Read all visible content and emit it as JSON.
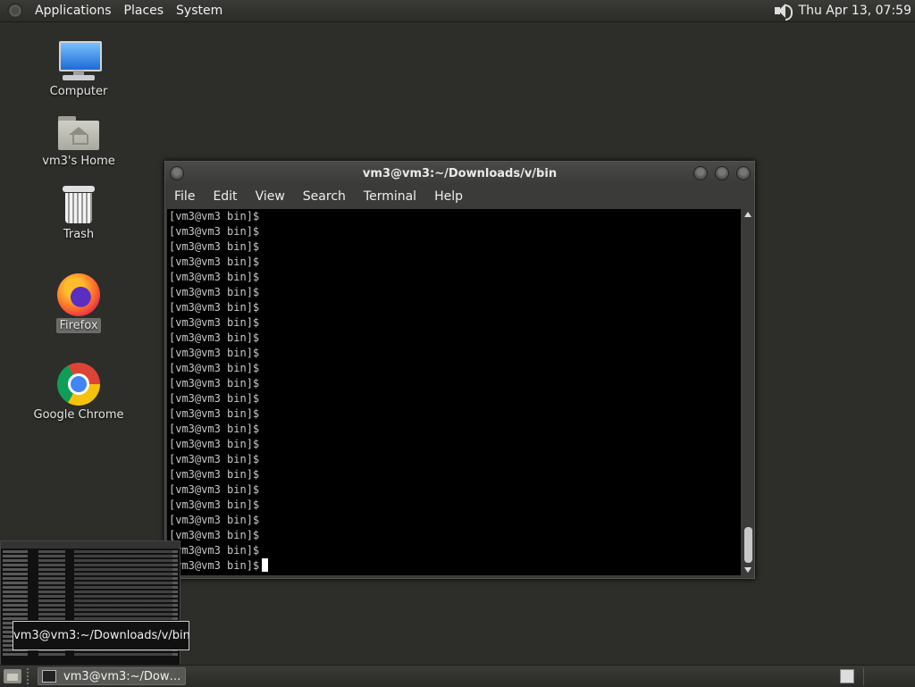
{
  "top_panel": {
    "menus": [
      "Applications",
      "Places",
      "System"
    ],
    "clock": "Thu Apr 13, 07:59"
  },
  "desktop": {
    "icons": [
      {
        "label": "Computer",
        "icon": "computer-icon"
      },
      {
        "label": "vm3's Home",
        "icon": "home-folder-icon"
      },
      {
        "label": "Trash",
        "icon": "trash-icon"
      },
      {
        "label": "Firefox",
        "icon": "firefox-icon",
        "selected": true
      },
      {
        "label": "Google Chrome",
        "icon": "chrome-icon"
      }
    ]
  },
  "terminal": {
    "title": "vm3@vm3:~/Downloads/v/bin",
    "menu": [
      "File",
      "Edit",
      "View",
      "Search",
      "Terminal",
      "Help"
    ],
    "lines": [
      "[vm3@vm3 bin]$",
      "[vm3@vm3 bin]$",
      "[vm3@vm3 bin]$",
      "[vm3@vm3 bin]$",
      "[vm3@vm3 bin]$",
      "[vm3@vm3 bin]$",
      "[vm3@vm3 bin]$",
      "[vm3@vm3 bin]$",
      "[vm3@vm3 bin]$",
      "[vm3@vm3 bin]$",
      "[vm3@vm3 bin]$",
      "[vm3@vm3 bin]$",
      "[vm3@vm3 bin]$",
      "[vm3@vm3 bin]$",
      "[vm3@vm3 bin]$",
      "[vm3@vm3 bin]$",
      "[vm3@vm3 bin]$",
      "[vm3@vm3 bin]$",
      "[vm3@vm3 bin]$",
      "[vm3@vm3 bin]$",
      "[vm3@vm3 bin]$",
      "[vm3@vm3 bin]$",
      "[vm3@vm3 bin]$",
      "[vm3@vm3 bin]$"
    ]
  },
  "tooltip": "vm3@vm3:~/Downloads/v/bin",
  "taskbar": {
    "task_label": "vm3@vm3:~/Downl..."
  }
}
